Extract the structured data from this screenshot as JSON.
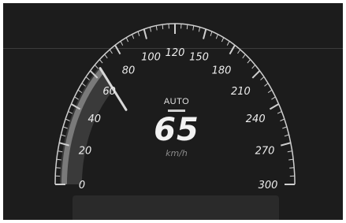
{
  "speedometer": {
    "mode": "AUTO",
    "speed": "65",
    "unit": "km/h",
    "min": 0,
    "max": 300,
    "current": 65,
    "tick_labels": [
      "0",
      "20",
      "40",
      "60",
      "80",
      "100",
      "120",
      "150",
      "180",
      "210",
      "240",
      "270",
      "300"
    ]
  },
  "colors": {
    "background": "#1c1c1c",
    "scale": "#cfcfcf",
    "fill": "#3a3a3a",
    "active_band": "#7a7a7a",
    "needle": "#d8d8d8"
  }
}
